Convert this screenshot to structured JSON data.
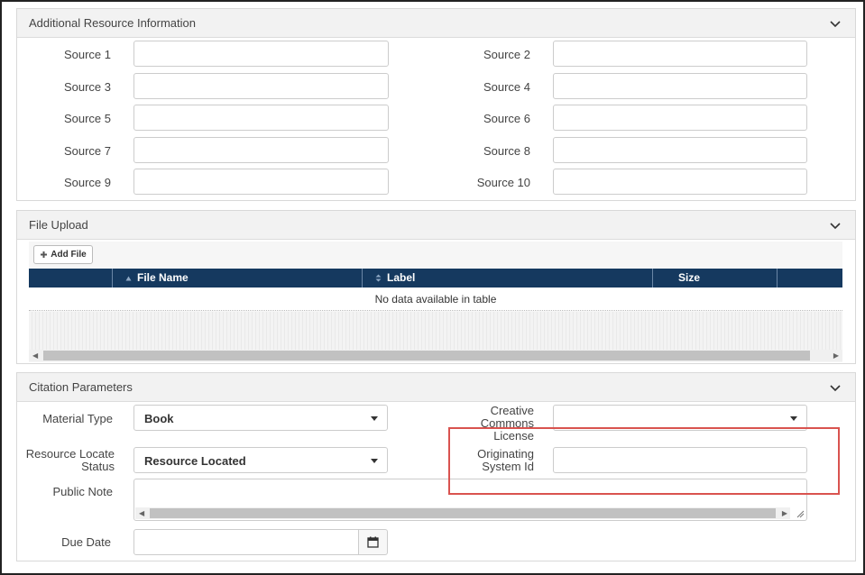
{
  "additional_resource": {
    "title": "Additional Resource Information",
    "sources": [
      {
        "label": "Source 1",
        "value": ""
      },
      {
        "label": "Source 2",
        "value": ""
      },
      {
        "label": "Source 3",
        "value": ""
      },
      {
        "label": "Source 4",
        "value": ""
      },
      {
        "label": "Source 5",
        "value": ""
      },
      {
        "label": "Source 6",
        "value": ""
      },
      {
        "label": "Source 7",
        "value": ""
      },
      {
        "label": "Source 8",
        "value": ""
      },
      {
        "label": "Source 9",
        "value": ""
      },
      {
        "label": "Source 10",
        "value": ""
      }
    ]
  },
  "file_upload": {
    "title": "File Upload",
    "add_file_label": "Add File",
    "columns": [
      "File Name",
      "Label",
      "Size"
    ],
    "empty_message": "No data available in table"
  },
  "citation": {
    "title": "Citation Parameters",
    "material_type_label": "Material Type",
    "material_type_value": "Book",
    "creative_commons_label_1": "Creative",
    "creative_commons_label_2": "Commons",
    "creative_commons_label_3": "License",
    "creative_commons_value": "",
    "resource_locate_label_1": "Resource Locate",
    "resource_locate_label_2": "Status",
    "resource_locate_value": "Resource Located",
    "originating_label_1": "Originating",
    "originating_label_2": "System Id",
    "originating_value": "",
    "public_note_label": "Public Note",
    "public_note_value": "",
    "due_date_label": "Due Date",
    "due_date_value": ""
  },
  "icons": {
    "chevron": "chevron-down-icon",
    "add": "plus-icon",
    "sort": "sort-icon",
    "calendar": "calendar-icon"
  },
  "colors": {
    "table_header": "#15395f",
    "highlight": "#d9534f"
  }
}
